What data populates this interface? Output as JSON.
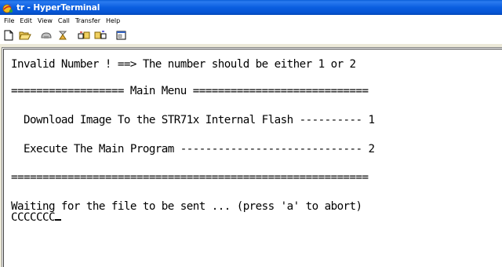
{
  "window": {
    "title": "tr - HyperTerminal"
  },
  "menu": {
    "items": [
      "File",
      "Edit",
      "View",
      "Call",
      "Transfer",
      "Help"
    ]
  },
  "toolbar": {
    "buttons": [
      "new-icon",
      "open-icon",
      "connect-icon",
      "disconnect-icon",
      "send-icon",
      "receive-icon",
      "properties-icon"
    ]
  },
  "terminal": {
    "lines": [
      "Invalid Number ! ==> The number should be either 1 or 2",
      "================== Main Menu ============================",
      "  Download Image To the STR71x Internal Flash ---------- 1",
      "  Execute The Main Program ----------------------------- 2",
      "=========================================================",
      "Waiting for the file to be sent ... (press 'a' to abort)",
      "CCCCCCC"
    ]
  },
  "colors": {
    "titlebar": "#0a5ee0",
    "title_text": "#ffffff",
    "terminal_bg": "#ffffff",
    "terminal_text": "#000000"
  }
}
